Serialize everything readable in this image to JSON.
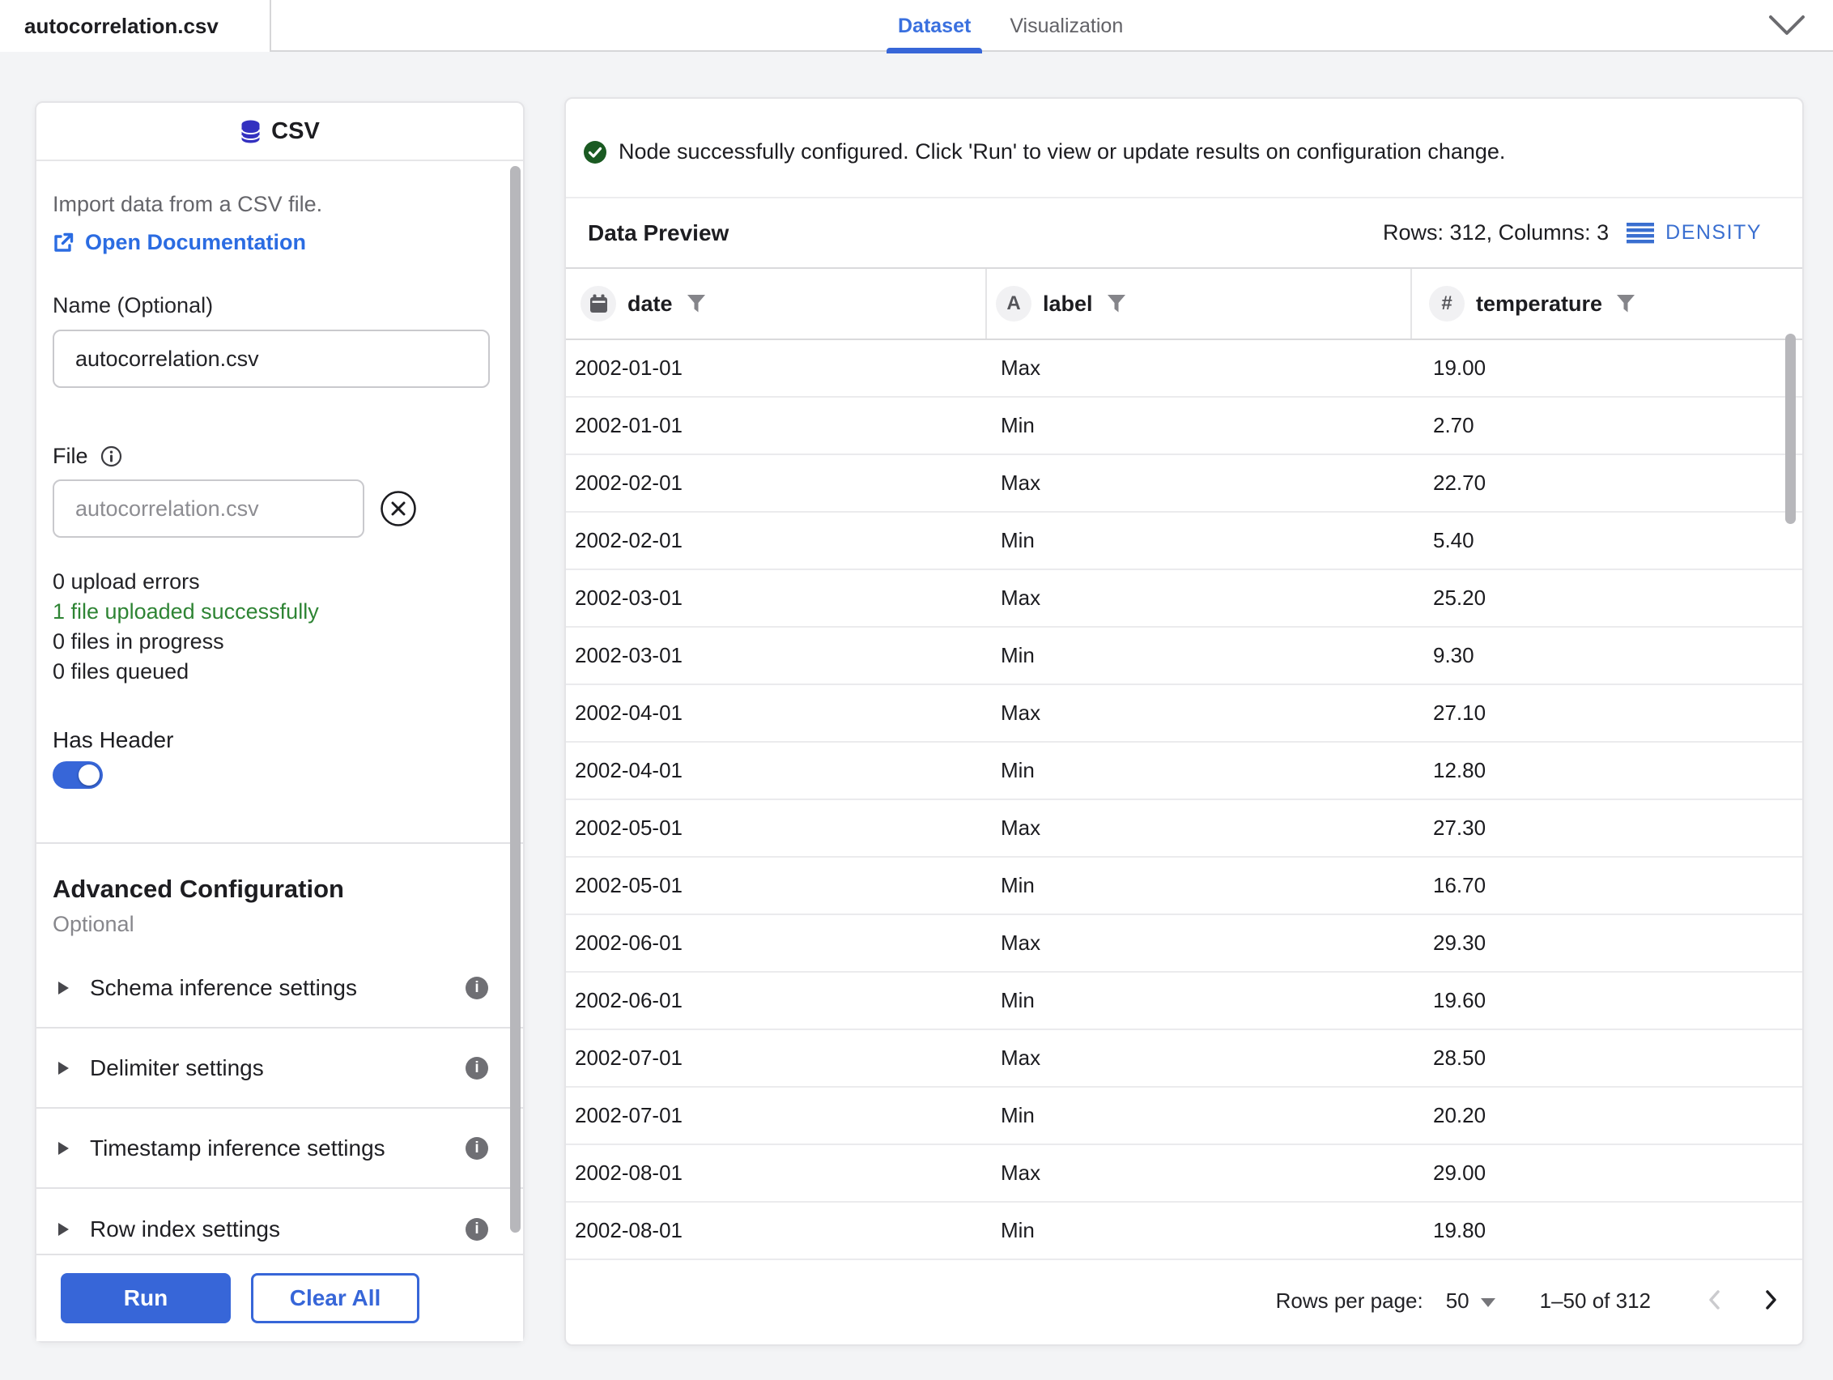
{
  "topbar": {
    "file_tab": "autocorrelation.csv",
    "tabs": [
      {
        "label": "Dataset",
        "active": true
      },
      {
        "label": "Visualization",
        "active": false
      }
    ]
  },
  "csv_panel": {
    "title": "CSV",
    "description": "Import data from a CSV file.",
    "doc_link_label": "Open Documentation",
    "name_label": "Name (Optional)",
    "name_value": "autocorrelation.csv",
    "file_label": "File",
    "file_value": "autocorrelation.csv",
    "upload_status": [
      {
        "text": "0 upload errors",
        "state": "normal"
      },
      {
        "text": "1 file uploaded successfully",
        "state": "success"
      },
      {
        "text": "0 files in progress",
        "state": "normal"
      },
      {
        "text": "0 files queued",
        "state": "normal"
      }
    ],
    "has_header_label": "Has Header",
    "has_header_on": true,
    "advanced": {
      "title": "Advanced Configuration",
      "subtitle": "Optional",
      "items": [
        "Schema inference settings",
        "Delimiter settings",
        "Timestamp inference settings",
        "Row index settings"
      ]
    },
    "run_label": "Run",
    "clear_label": "Clear All"
  },
  "results": {
    "status_message": "Node successfully configured. Click 'Run' to view or update results on configuration change.",
    "preview": {
      "title": "Data Preview",
      "summary": "Rows: 312, Columns: 3",
      "density_label": "DENSITY",
      "columns": [
        {
          "name": "date",
          "type": "date"
        },
        {
          "name": "label",
          "type": "string",
          "badge": "A"
        },
        {
          "name": "temperature",
          "type": "number",
          "badge": "#"
        }
      ],
      "rows": [
        [
          "2002-01-01",
          "Max",
          "19.00"
        ],
        [
          "2002-01-01",
          "Min",
          "2.70"
        ],
        [
          "2002-02-01",
          "Max",
          "22.70"
        ],
        [
          "2002-02-01",
          "Min",
          "5.40"
        ],
        [
          "2002-03-01",
          "Max",
          "25.20"
        ],
        [
          "2002-03-01",
          "Min",
          "9.30"
        ],
        [
          "2002-04-01",
          "Max",
          "27.10"
        ],
        [
          "2002-04-01",
          "Min",
          "12.80"
        ],
        [
          "2002-05-01",
          "Max",
          "27.30"
        ],
        [
          "2002-05-01",
          "Min",
          "16.70"
        ],
        [
          "2002-06-01",
          "Max",
          "29.30"
        ],
        [
          "2002-06-01",
          "Min",
          "19.60"
        ],
        [
          "2002-07-01",
          "Max",
          "28.50"
        ],
        [
          "2002-07-01",
          "Min",
          "20.20"
        ],
        [
          "2002-08-01",
          "Max",
          "29.00"
        ],
        [
          "2002-08-01",
          "Min",
          "19.80"
        ]
      ],
      "pagination": {
        "rows_per_page_label": "Rows per page:",
        "rows_per_page": "50",
        "range": "1–50 of 312"
      }
    }
  },
  "colors": {
    "accent_blue": "#3766d8",
    "link_blue": "#2b6ce2",
    "density_blue": "#3a6fd0",
    "success_text_green": "#2e8434",
    "success_icon_green": "#1a5a22",
    "csv_icon_indigo": "#3431c0",
    "page_background": "#f3f4f6"
  }
}
